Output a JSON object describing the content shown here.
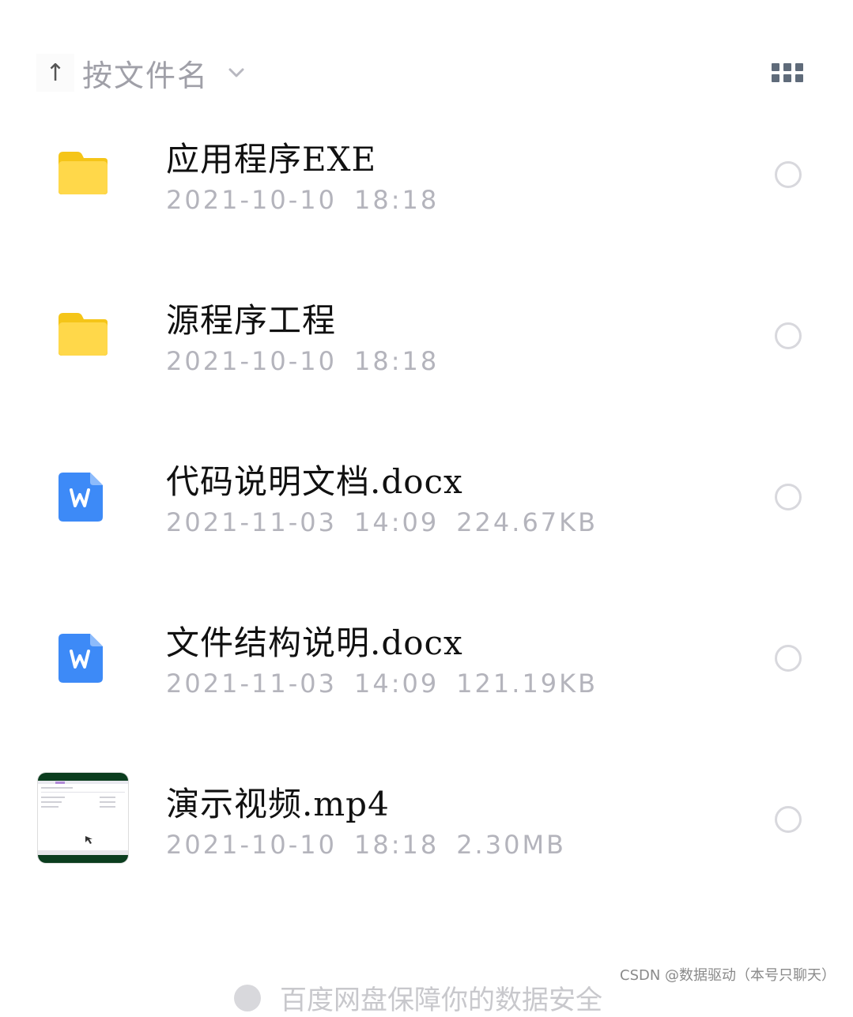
{
  "sort": {
    "arrow_icon": "arrow-up-icon",
    "label": "按文件名",
    "chevron_icon": "chevron-down-icon"
  },
  "view_toggle_icon": "grid-view-icon",
  "files": [
    {
      "name": "应用程序EXE",
      "date": "2021-10-10",
      "time": "18:18",
      "size": "",
      "icon": "folder-icon"
    },
    {
      "name": "源程序工程",
      "date": "2021-10-10",
      "time": "18:18",
      "size": "",
      "icon": "folder-icon"
    },
    {
      "name": "代码说明文档.docx",
      "date": "2021-11-03",
      "time": "14:09",
      "size": "224.67KB",
      "icon": "word-doc-icon"
    },
    {
      "name": "文件结构说明.docx",
      "date": "2021-11-03",
      "time": "14:09",
      "size": "121.19KB",
      "icon": "word-doc-icon"
    },
    {
      "name": "演示视频.mp4",
      "date": "2021-10-10",
      "time": "18:18",
      "size": "2.30MB",
      "icon": "video-thumbnail"
    }
  ],
  "footer": {
    "note": "百度网盘保障你的数据安全"
  },
  "watermark": "CSDN @数据驱动（本号只聊天）",
  "colors": {
    "folder": "#ffd43b",
    "word": "#3d8af7",
    "meta_text": "#b4b4bc"
  }
}
